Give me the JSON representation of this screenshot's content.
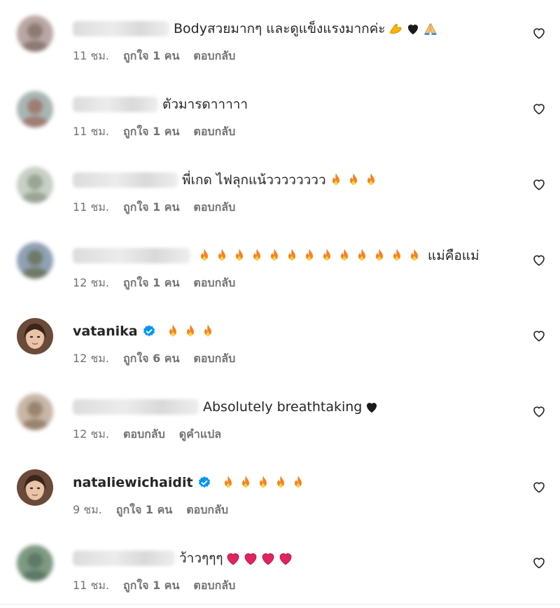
{
  "comments": [
    {
      "user": "",
      "blurred": true,
      "verified": false,
      "text": "Bodyสวยมากๆ และดูแข็งแรงมากค่ะ",
      "emojis": [
        "muscle",
        "black-heart",
        "pray"
      ],
      "text_after": "",
      "time": "11 ชม.",
      "likes": "ถูกใจ 1 คน",
      "reply": "ตอบกลับ",
      "translate": ""
    },
    {
      "user": "",
      "blurred": true,
      "verified": false,
      "text": "ตัวมารดาาาาา",
      "emojis": [],
      "text_after": "",
      "time": "11 ชม.",
      "likes": "ถูกใจ 1 คน",
      "reply": "ตอบกลับ",
      "translate": ""
    },
    {
      "user": "",
      "blurred": true,
      "verified": false,
      "text": "พี่เกด ไฟลุกแน้วววววววว",
      "emojis": [
        "fire",
        "fire",
        "fire"
      ],
      "text_after": "",
      "time": "11 ชม.",
      "likes": "ถูกใจ 1 คน",
      "reply": "ตอบกลับ",
      "translate": ""
    },
    {
      "user": "",
      "blurred": true,
      "verified": false,
      "text": "",
      "emojis": [
        "fire",
        "fire",
        "fire",
        "fire",
        "fire",
        "fire",
        "fire",
        "fire",
        "fire",
        "fire",
        "fire",
        "fire",
        "fire"
      ],
      "text_after": "แม่คือแม่",
      "time": "12 ชม.",
      "likes": "ถูกใจ 1 คน",
      "reply": "ตอบกลับ",
      "translate": ""
    },
    {
      "user": "vatanika",
      "blurred": false,
      "verified": true,
      "text": "",
      "emojis": [
        "fire",
        "fire",
        "fire"
      ],
      "text_after": "",
      "time": "12 ชม.",
      "likes": "ถูกใจ 6 คน",
      "reply": "ตอบกลับ",
      "translate": ""
    },
    {
      "user": "",
      "blurred": true,
      "verified": false,
      "text": "Absolutely breathtaking",
      "emojis": [
        "black-heart"
      ],
      "text_after": "",
      "time": "12 ชม.",
      "likes": "",
      "reply": "ตอบกลับ",
      "translate": "ดูคำแปล"
    },
    {
      "user": "nataliewichaidit",
      "blurred": false,
      "verified": true,
      "text": "",
      "emojis": [
        "fire",
        "fire",
        "fire",
        "fire",
        "fire"
      ],
      "text_after": "",
      "time": "9 ชม.",
      "likes": "ถูกใจ 1 คน",
      "reply": "ตอบกลับ",
      "translate": ""
    },
    {
      "user": "",
      "blurred": true,
      "verified": false,
      "text": "ว้าวๆๆๆ",
      "emojis": [
        "red-heart",
        "red-heart",
        "red-heart",
        "red-heart"
      ],
      "text_after": "",
      "time": "11 ชม.",
      "likes": "ถูกใจ 1 คน",
      "reply": "ตอบกลับ",
      "translate": ""
    }
  ],
  "colors": {
    "text": "#262626",
    "meta": "#737373",
    "verified": "#0095f6",
    "heart_red": "#e0245e",
    "fire": "#f6821f"
  }
}
